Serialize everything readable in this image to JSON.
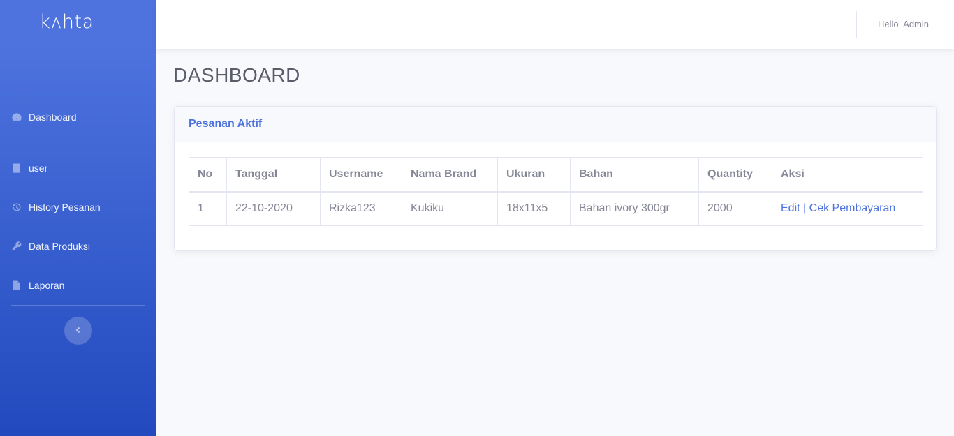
{
  "sidebar": {
    "brand": "kʌhta",
    "items": [
      {
        "label": "Dashboard",
        "icon": "tachometer-icon"
      },
      {
        "label": "user",
        "icon": "book-icon"
      },
      {
        "label": "History Pesanan",
        "icon": "history-icon"
      },
      {
        "label": "Data Produksi",
        "icon": "wrench-icon"
      },
      {
        "label": "Laporan",
        "icon": "file-icon"
      }
    ],
    "toggle_icon": "chevron-left-icon"
  },
  "topbar": {
    "greeting": "Hello, Admin"
  },
  "main": {
    "page_title": "DASHBOARD",
    "card_title": "Pesanan Aktif",
    "table": {
      "headers": [
        "No",
        "Tanggal",
        "Username",
        "Nama Brand",
        "Ukuran",
        "Bahan",
        "Quantity",
        "Aksi"
      ],
      "rows": [
        {
          "no": "1",
          "tanggal": "22-10-2020",
          "username": "Rizka123",
          "nama_brand": "Kukiku",
          "ukuran": "18x11x5",
          "bahan": "Bahan ivory 300gr",
          "quantity": "2000",
          "edit_label": "Edit",
          "separator": "|",
          "cek_label": "Cek Pembayaran"
        }
      ]
    }
  },
  "colors": {
    "primary": "#4e73df",
    "sidebar_gradient_end": "#224abe",
    "text": "#858796",
    "heading": "#5a5c69"
  }
}
